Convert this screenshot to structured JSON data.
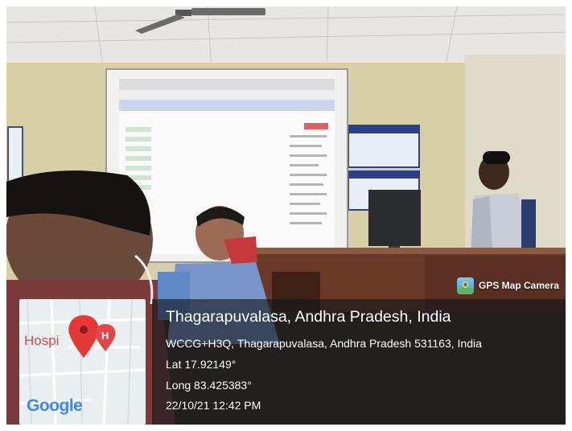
{
  "watermark": {
    "app_name": "GPS Map Camera",
    "place_title": "Thagarapuvalasa, Andhra Pradesh, India",
    "address": "WCCG+H3Q, Thagarapuvalasa, Andhra Pradesh 531163, India",
    "latitude": "Lat 17.92149°",
    "longitude": "Long 83.425383°",
    "datetime": "22/10/21 12:42 PM"
  },
  "map": {
    "poi_label": "Hospi",
    "poi_letter": "H",
    "logo": "Google",
    "pin_icon": "map-pin-icon",
    "hospital_icon": "hospital-marker-icon"
  },
  "colors": {
    "pin_red": "#e53935",
    "panel_bg": "#141619"
  }
}
